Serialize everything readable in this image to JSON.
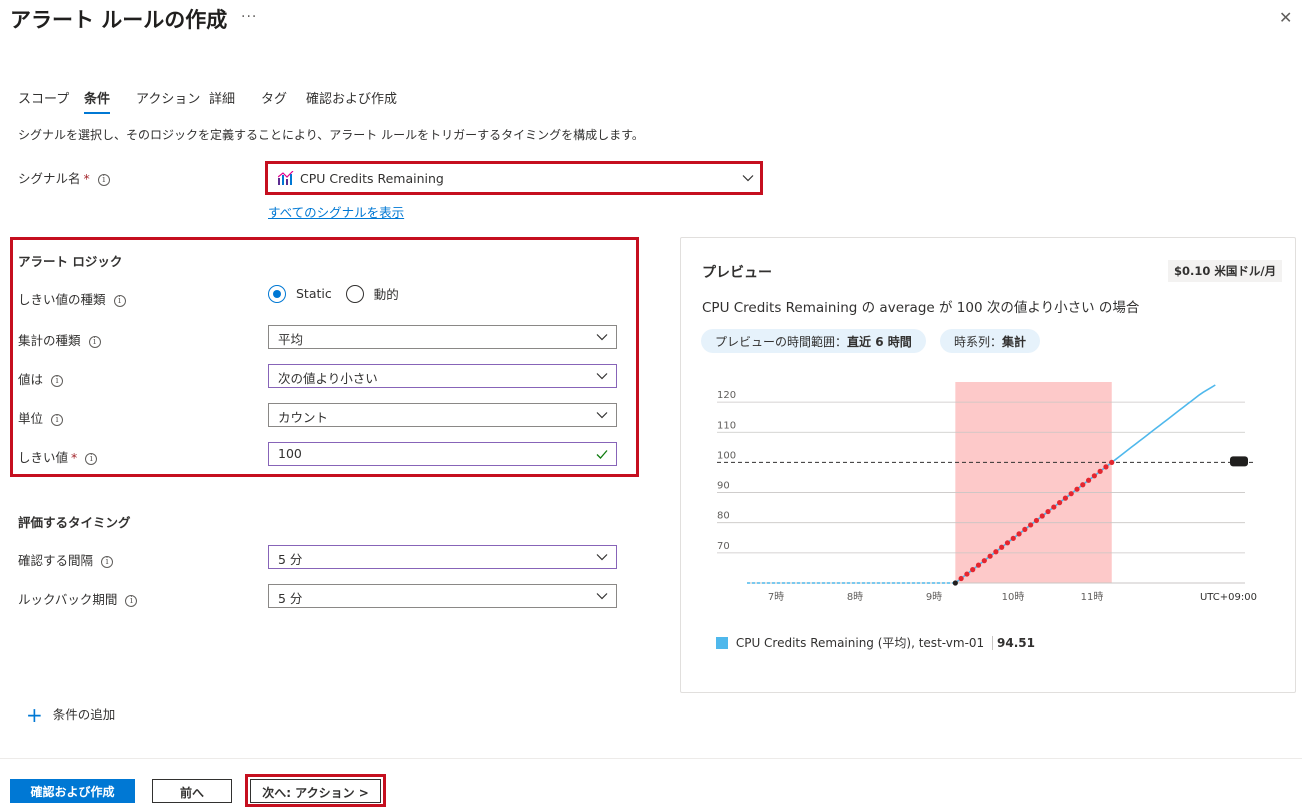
{
  "header": {
    "title": "アラート ルールの作成",
    "more": "···",
    "close": "✕"
  },
  "tabs": [
    {
      "label": "スコープ"
    },
    {
      "label": "条件"
    },
    {
      "label": "アクション"
    },
    {
      "label": "詳細"
    },
    {
      "label": "タグ"
    },
    {
      "label": "確認および作成"
    }
  ],
  "description": "シグナルを選択し、そのロジックを定義することにより、アラート ルールをトリガーするタイミングを構成します。",
  "signal": {
    "label": "シグナル名",
    "required": "*",
    "value": "CPU Credits Remaining",
    "link": "すべてのシグナルを表示"
  },
  "alert_logic": {
    "heading": "アラート ロジック",
    "threshold_type_label": "しきい値の種類",
    "threshold_type_options": [
      "Static",
      "動的"
    ],
    "threshold_type_selected": "Static",
    "aggregation_label": "集計の種類",
    "aggregation_value": "平均",
    "operator_label": "値は",
    "operator_value": "次の値より小さい",
    "unit_label": "単位",
    "unit_value": "カウント",
    "threshold_label": "しきい値",
    "threshold_required": "*",
    "threshold_value": "100"
  },
  "evaluation": {
    "heading": "評価するタイミング",
    "frequency_label": "確認する間隔",
    "frequency_value": "5 分",
    "lookback_label": "ルックバック期間",
    "lookback_value": "5 分"
  },
  "add_condition": "条件の追加",
  "preview": {
    "title": "プレビュー",
    "price": "$0.10 米国ドル/月",
    "summary": "CPU Credits Remaining の average が 100 次の値より小さい の場合",
    "range_label": "プレビューの時間範囲：",
    "range_value": "直近 6 時間",
    "series_label": "時系列：",
    "series_value": "集計",
    "legend_name": "CPU Credits Remaining (平均), test-vm-01",
    "legend_value": "94.51",
    "timezone": "UTC+09:00"
  },
  "chart_data": {
    "type": "line",
    "y_ticks": [
      70,
      80,
      90,
      100,
      110,
      120
    ],
    "x_ticks": [
      "7時",
      "8時",
      "9時",
      "10時",
      "11時"
    ],
    "ylim": [
      60,
      128
    ],
    "threshold": 100,
    "line_color": "#4fb8ec",
    "alert_fill": "#fdc9c9",
    "alert_dot_color": "#e3262f"
  },
  "footer": {
    "review_button": "確認および作成",
    "prev_button": "前へ",
    "next_button": "次へ: アクション >"
  },
  "colors": {
    "accent": "#0078d4",
    "highlight_red": "#c50f1f"
  }
}
